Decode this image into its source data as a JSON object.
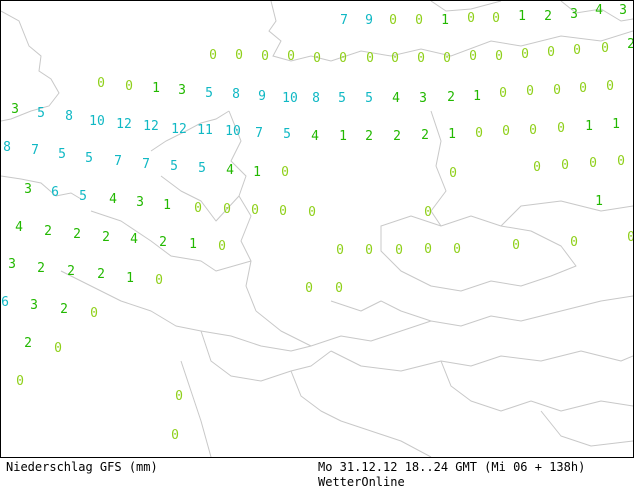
{
  "footer": {
    "title": "Niederschlag GFS (mm)",
    "run": "Mo 31.12.12 18..24 GMT (Mi 06 + 138h)",
    "brand": "WetterOnline"
  },
  "colors": {
    "zero": "#8fd01a",
    "low": "#22b800",
    "high": "#10b8c4",
    "border": "#c8c8c8"
  },
  "precipitation_values": [
    "0",
    "0",
    "1",
    "2",
    "3",
    "4",
    "3",
    "7",
    "9",
    "0",
    "0",
    "0",
    "0",
    "0",
    "0",
    "0",
    "0",
    "0",
    "0",
    "0",
    "0",
    "0",
    "0",
    "0",
    "0",
    "0",
    "0",
    "1",
    "2",
    "0",
    "0",
    "1",
    "3",
    "5",
    "8",
    "9",
    "10",
    "8",
    "5",
    "5",
    "4",
    "3",
    "2",
    "1",
    "0",
    "0",
    "0",
    "0",
    "0",
    "3",
    "5",
    "8",
    "10",
    "12",
    "12",
    "12",
    "11",
    "10",
    "7",
    "5",
    "4",
    "1",
    "2",
    "2",
    "2",
    "1",
    "0",
    "0",
    "0",
    "0",
    "1",
    "1",
    "8",
    "7",
    "5",
    "5",
    "7",
    "7",
    "5",
    "5",
    "4",
    "1",
    "0",
    "0",
    "0",
    "0",
    "0",
    "0",
    "3",
    "6",
    "5",
    "4",
    "3",
    "1",
    "0",
    "0",
    "0",
    "0",
    "0",
    "0",
    "1",
    "4",
    "2",
    "2",
    "2",
    "4",
    "2",
    "1",
    "0",
    "0",
    "0",
    "3",
    "2",
    "2",
    "2",
    "1",
    "0",
    "0",
    "0",
    "0",
    "0",
    "0",
    "0",
    "6",
    "3",
    "2",
    "0",
    "0",
    "0",
    "2",
    "0",
    "0",
    "0",
    "0"
  ]
}
